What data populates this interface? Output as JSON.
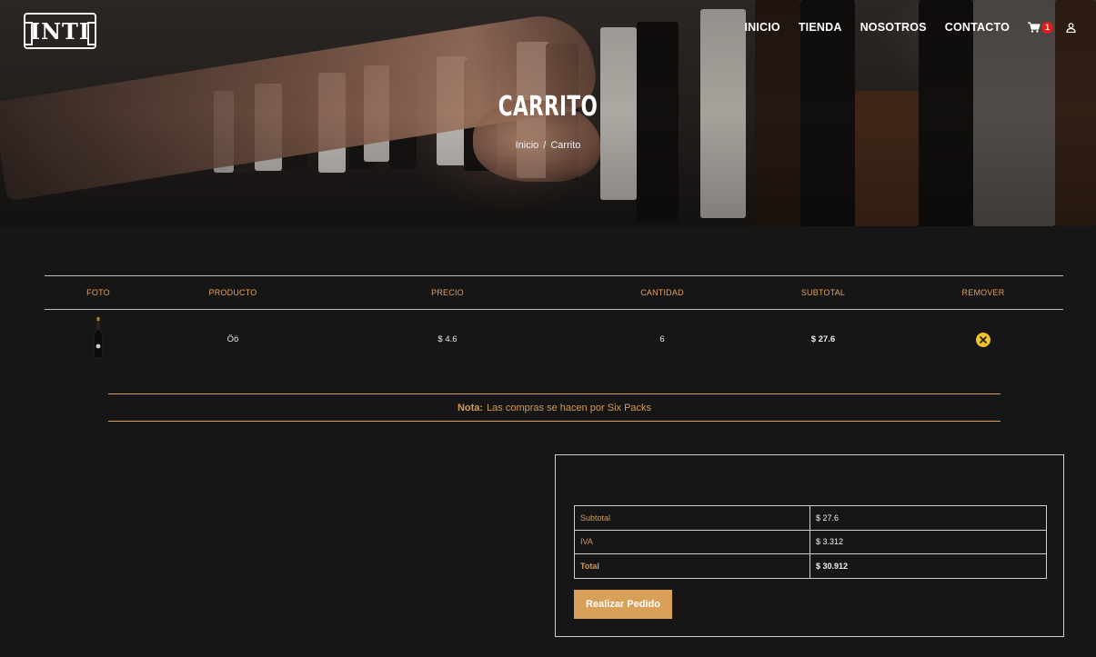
{
  "brand": {
    "logo_text": "INTI"
  },
  "nav": {
    "items": [
      {
        "label": "INICIO"
      },
      {
        "label": "TIENDA"
      },
      {
        "label": "NOSOTROS"
      },
      {
        "label": "CONTACTO"
      }
    ],
    "cart_count": "1",
    "cart_icon": "shopping-cart-icon",
    "user_icon": "user-icon"
  },
  "hero": {
    "title": "CARRITO",
    "breadcrumb": {
      "home": "Inicio",
      "separator": "/",
      "current": "Carrito"
    }
  },
  "cart": {
    "headers": [
      "FOTO",
      "PRODUCTO",
      "PRECIO",
      "CANTIDAD",
      "SUBTOTAL",
      "REMOVER"
    ],
    "rows": [
      {
        "product": "Öö",
        "price": "$ 4.6",
        "quantity": "6",
        "subtotal": "$ 27.6",
        "remove_icon": "close-icon"
      }
    ]
  },
  "note": {
    "label": "Nota:",
    "text": "Las compras se hacen por Six Packs"
  },
  "totals": {
    "rows": [
      {
        "label": "Subtotal",
        "value": "$ 27.6"
      },
      {
        "label": "IVA",
        "value": "$ 3.312"
      },
      {
        "label": "Total",
        "value": "$ 30.912"
      }
    ],
    "button": "Realizar Pedido"
  },
  "colors": {
    "accent": "#d9a05a",
    "badge": "#e01b1b",
    "remove": "#f2c230",
    "background": "#161616"
  }
}
